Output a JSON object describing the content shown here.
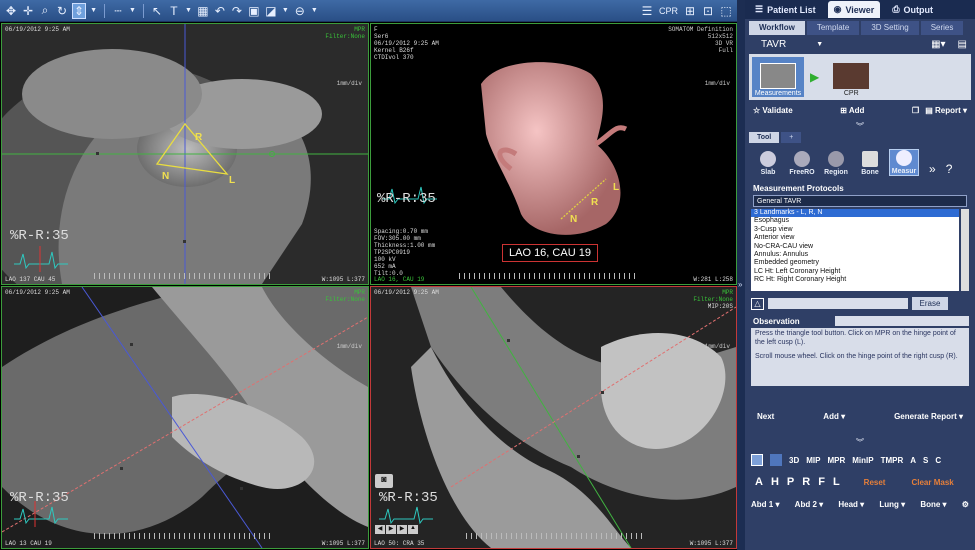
{
  "toolbar": {
    "cpr_label": "CPR"
  },
  "nav": {
    "patient_list": "Patient List",
    "viewer": "Viewer",
    "output": "Output"
  },
  "tabs": [
    "Workflow",
    "Template",
    "3D Setting",
    "Series"
  ],
  "workflow": {
    "protocol": "TAVR",
    "thumbs": [
      "Measurements",
      "CPR"
    ],
    "validate": "Validate",
    "add": "Add",
    "report": "Report"
  },
  "tool_tabs": [
    "Tool",
    "+"
  ],
  "tools": [
    "Slab",
    "FreeRO",
    "Region",
    "Bone",
    "Measur"
  ],
  "measurement": {
    "heading": "Measurement Protocols",
    "protocol_select": "General TAVR",
    "items": [
      "3 Landmarks - L, R, N",
      "Esophagus",
      "3-Cusp view",
      "Anterior view",
      "No-CRA-CAU view",
      "Annulus: Annulus",
      "Embedded geometry",
      "LC Ht: Left Coronary Height",
      "RC Ht: Right Coronary Height"
    ],
    "erase": "Erase",
    "observation": "Observation",
    "note1": "Press the triangle tool button. Click on MPR on the hinge point of the left cusp (L).",
    "note2": "Scroll mouse wheel. Click on the hinge point of the right cusp (R).",
    "next": "Next",
    "add": "Add",
    "generate": "Generate Report"
  },
  "modes": [
    "3D",
    "MIP",
    "MPR",
    "MinIP",
    "TMPR",
    "A",
    "S",
    "C"
  ],
  "letters": [
    "A",
    "H",
    "P",
    "R",
    "F",
    "L"
  ],
  "reset": "Reset",
  "clear_mask": "Clear Mask",
  "presets": [
    "Abd 1",
    "Abd 2",
    "Head",
    "Lung",
    "Bone"
  ],
  "vp1": {
    "date": "06/19/2012 9:25 AM",
    "tag": "MPR",
    "filter": "Filter:None",
    "scale": "1mm/div",
    "ori": "LAO 137 CAU 45",
    "wl": "W:1095 L:377",
    "pct": "%R-R:35",
    "labels": {
      "R": "R",
      "N": "N",
      "L": "L"
    }
  },
  "vp2": {
    "info": "F\nSer6\n06/19/2012 9:25 AM\nKernel B26f\nCTDIvol 370",
    "scanner": "SOMATOM Definition\n512x512\n3D VR\nFull",
    "scale": "1mm/div",
    "params": "Spacing:0.70 mm\nFOV:305.00 mm\nThickness:1.00 mm\nTP2SPC0919\n100 kV\n652 mA\nTilt:0.0",
    "ori": "LAO 16, CAU 19",
    "wl": "W:281 L:258",
    "pct": "%R-R:35",
    "label3d": "LAO 16, CAU 19",
    "labels": {
      "R": "R",
      "N": "N",
      "L": "L"
    }
  },
  "vp3": {
    "date": "06/19/2012 9:25 AM",
    "tag": "MPR",
    "filter": "Filter:None",
    "scale": "1mm/div",
    "ori": "LAO 13 CAU 19",
    "wl": "W:1095 L:377",
    "pct": "%R-R:35"
  },
  "vp4": {
    "date": "06/19/2012 9:25 AM",
    "tag": "MPR",
    "filter": "Filter:None",
    "scale": "1mm/div",
    "mip": "MIP:20S",
    "ori": "LAO 50: CRA 35",
    "wl": "W:1095 L:377",
    "pct": "%R-R:35"
  }
}
